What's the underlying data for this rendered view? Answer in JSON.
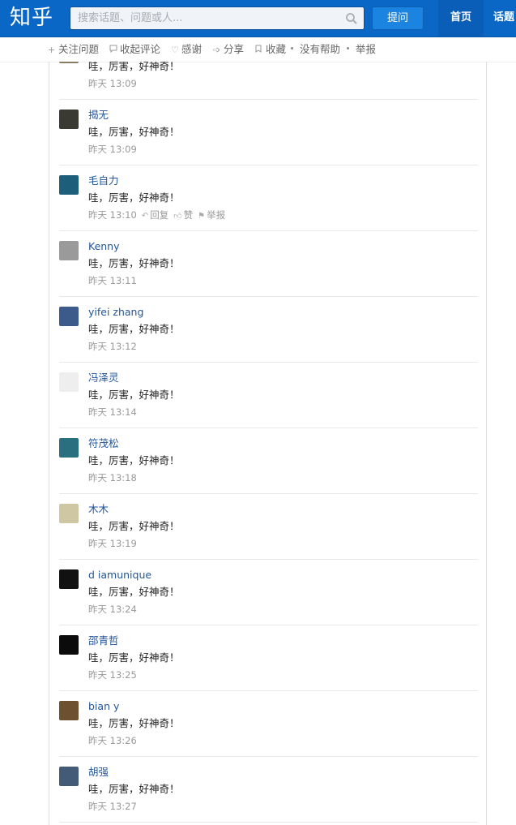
{
  "header": {
    "logo": "知乎",
    "search_placeholder": "搜索话题、问题或人...",
    "ask_label": "提问",
    "nav_home": "首页",
    "nav_topics": "话题"
  },
  "actions": {
    "follow": "关注问题",
    "collapse_comments": "收起评论",
    "thanks": "感谢",
    "share": "分享",
    "collect": "收藏",
    "not_helpful": "没有帮助",
    "report": "举报"
  },
  "comment_actions": {
    "reply": "回复",
    "like": "赞",
    "report": "举报"
  },
  "comments": [
    {
      "name": "",
      "text": "哇，厉害，好神奇！",
      "time": "昨天 13:09",
      "avatar_color": "#8a7a62"
    },
    {
      "name": "揭无",
      "text": "哇，厉害，好神奇！",
      "time": "昨天 13:09",
      "avatar_color": "#3a3a32"
    },
    {
      "name": "毛自力",
      "text": "哇，厉害，好神奇！",
      "time": "昨天 13:10",
      "avatar_color": "#1d5f7a",
      "hovered": true
    },
    {
      "name": "Kenny",
      "text": "哇，厉害，好神奇！",
      "time": "昨天 13:11",
      "avatar_color": "#9a9a9a"
    },
    {
      "name": "yifei zhang",
      "text": "哇，厉害，好神奇！",
      "time": "昨天 13:12",
      "avatar_color": "#3c5a8a"
    },
    {
      "name": "冯泽灵",
      "text": "哇，厉害，好神奇！",
      "time": "昨天 13:14",
      "avatar_color": "#eeeeee"
    },
    {
      "name": "符茂松",
      "text": "哇，厉害，好神奇！",
      "time": "昨天 13:18",
      "avatar_color": "#2a6f7f"
    },
    {
      "name": "木木",
      "text": "哇，厉害，好神奇！",
      "time": "昨天 13:19",
      "avatar_color": "#cfc7a4"
    },
    {
      "name": "d iamunique",
      "text": "哇，厉害，好神奇！",
      "time": "昨天 13:24",
      "avatar_color": "#111111"
    },
    {
      "name": "邵青哲",
      "text": "哇，厉害，好神奇！",
      "time": "昨天 13:25",
      "avatar_color": "#0b0b0b"
    },
    {
      "name": "bian y",
      "text": "哇，厉害，好神奇！",
      "time": "昨天 13:26",
      "avatar_color": "#6d5030"
    },
    {
      "name": "胡强",
      "text": "哇，厉害，好神奇！",
      "time": "昨天 13:27",
      "avatar_color": "#445b78"
    }
  ],
  "colors": {
    "brand": "#0a67c6",
    "link": "#225599"
  }
}
